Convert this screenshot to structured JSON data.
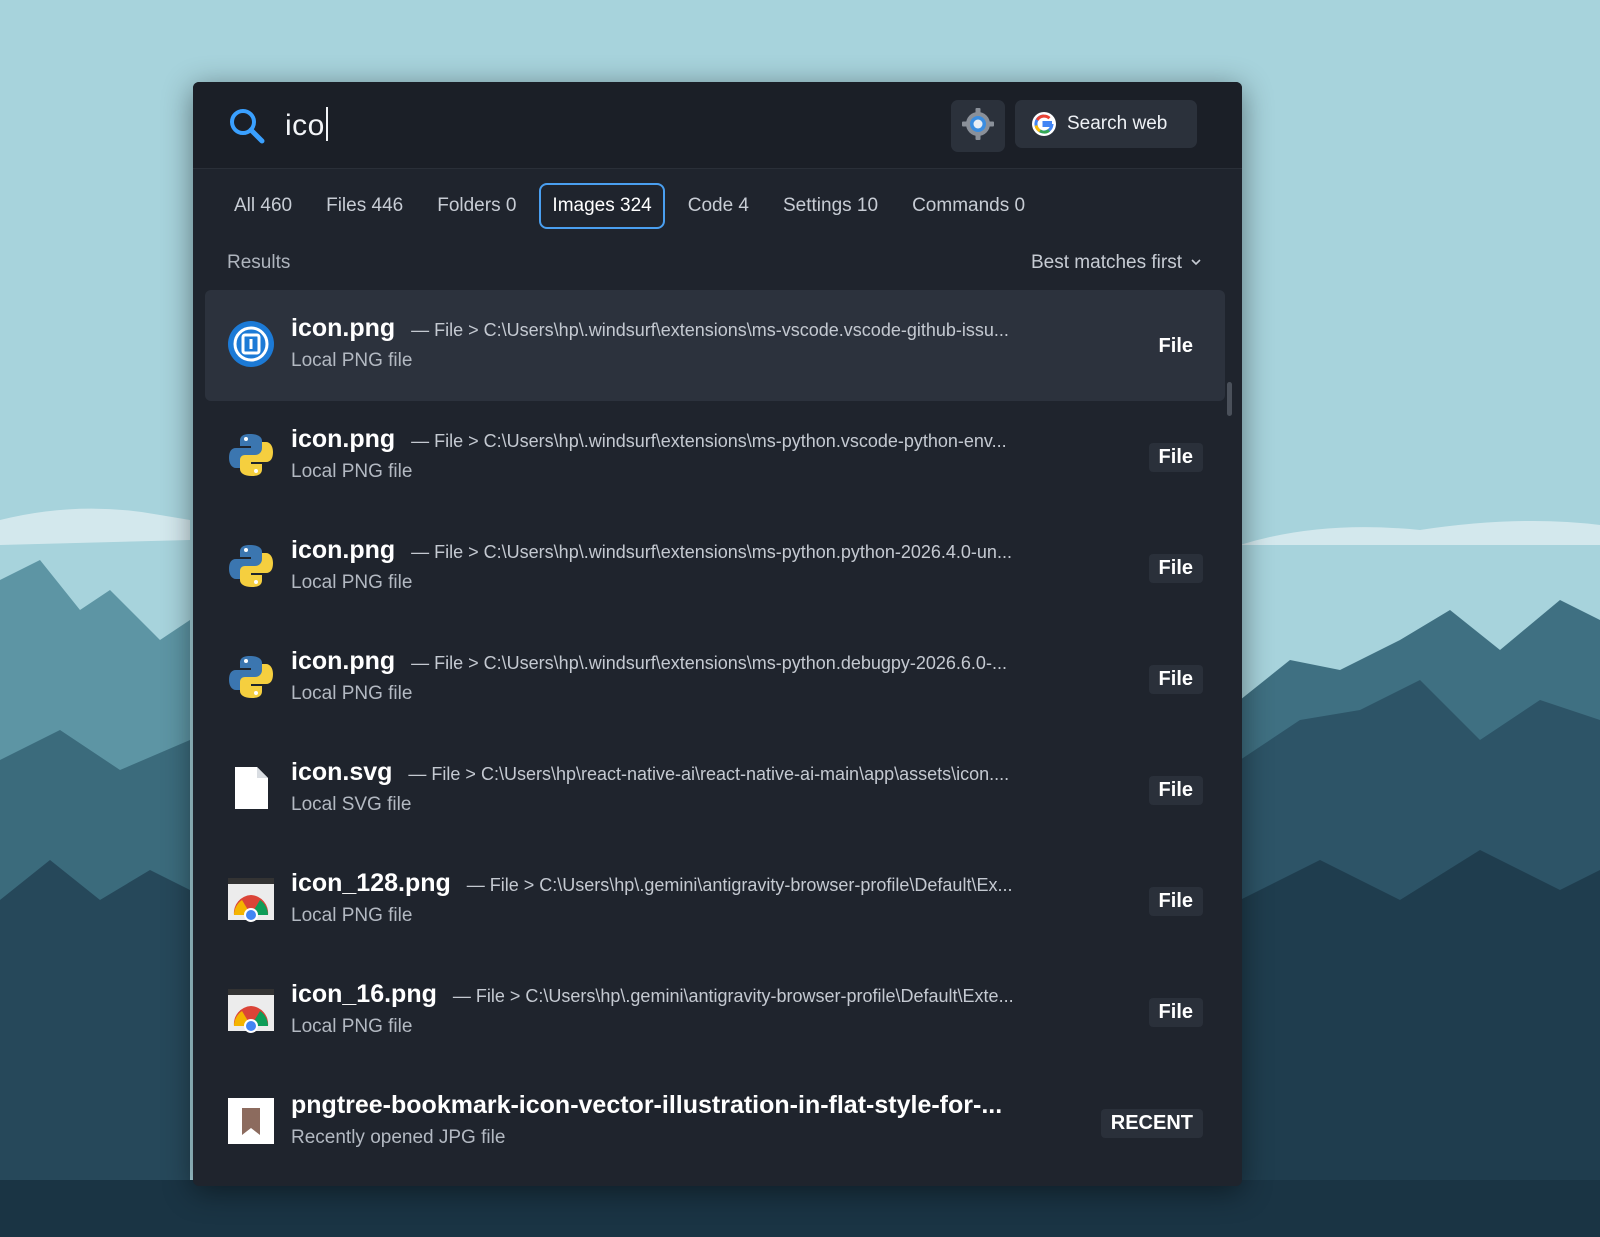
{
  "search": {
    "query": "ico",
    "search_web_label": "Search web"
  },
  "tabs": [
    {
      "label": "All 460",
      "active": false
    },
    {
      "label": "Files 446",
      "active": false
    },
    {
      "label": "Folders 0",
      "active": false
    },
    {
      "label": "Images 324",
      "active": true
    },
    {
      "label": "Code 4",
      "active": false
    },
    {
      "label": "Settings 10",
      "active": false
    },
    {
      "label": "Commands 0",
      "active": false
    }
  ],
  "results": {
    "label": "Results",
    "sort_label": "Best matches first",
    "items": [
      {
        "icon": "vscode-issue-icon",
        "name": "icon.png",
        "path": "— File > C:\\Users\\hp\\.windsurf\\extensions\\ms-vscode.vscode-github-issu...",
        "sub": "Local PNG file",
        "tag": "File"
      },
      {
        "icon": "python-icon",
        "name": "icon.png",
        "path": "— File > C:\\Users\\hp\\.windsurf\\extensions\\ms-python.vscode-python-env...",
        "sub": "Local PNG file",
        "tag": "File"
      },
      {
        "icon": "python-icon",
        "name": "icon.png",
        "path": "— File > C:\\Users\\hp\\.windsurf\\extensions\\ms-python.python-2026.4.0-un...",
        "sub": "Local PNG file",
        "tag": "File"
      },
      {
        "icon": "python-icon",
        "name": "icon.png",
        "path": "— File > C:\\Users\\hp\\.windsurf\\extensions\\ms-python.debugpy-2026.6.0-...",
        "sub": "Local PNG file",
        "tag": "File"
      },
      {
        "icon": "blank-file-icon",
        "name": "icon.svg",
        "path": "— File > C:\\Users\\hp\\react-native-ai\\react-native-ai-main\\app\\assets\\icon....",
        "sub": "Local SVG file",
        "tag": "File"
      },
      {
        "icon": "chrome-icon",
        "name": "icon_128.png",
        "path": "— File > C:\\Users\\hp\\.gemini\\antigravity-browser-profile\\Default\\Ex...",
        "sub": "Local PNG file",
        "tag": "File"
      },
      {
        "icon": "chrome-icon",
        "name": "icon_16.png",
        "path": "— File > C:\\Users\\hp\\.gemini\\antigravity-browser-profile\\Default\\Exte...",
        "sub": "Local PNG file",
        "tag": "File"
      },
      {
        "icon": "bookmark-icon",
        "name": "pngtree-bookmark-icon-vector-illustration-in-flat-style-for-...",
        "path": "",
        "sub": "Recently opened JPG file",
        "tag": "RECENT"
      }
    ]
  },
  "colors": {
    "accent": "#4a9ff0",
    "panel": "#1f242d",
    "selected_row": "#2c323d",
    "sky": "#a7d3dc"
  }
}
